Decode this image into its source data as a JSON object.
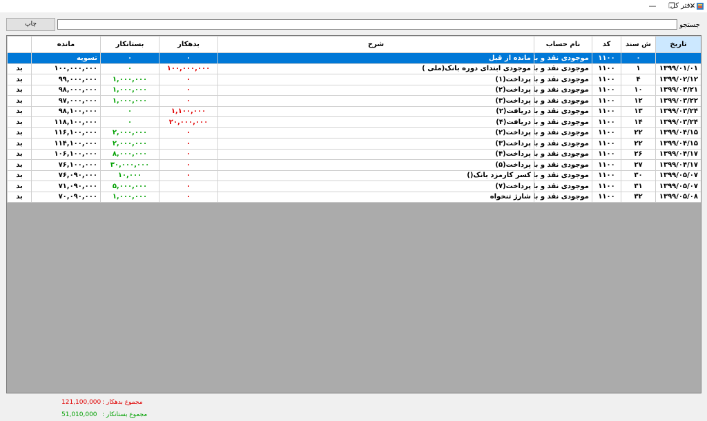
{
  "window": {
    "title": "دفتر کل",
    "minimize_glyph": "—",
    "restore_glyph": "❐",
    "close_glyph": "✕"
  },
  "search": {
    "label": "جستجو :",
    "value": "",
    "placeholder": ""
  },
  "toolbar": {
    "print_label": "چاپ"
  },
  "grid": {
    "headers": {
      "stub": "",
      "balance": "مانده",
      "credit": "بستانکار",
      "debit": "بدهکار",
      "description": "شرح",
      "account": "نام حساب",
      "code": "کد",
      "doc_no": "ش سند",
      "date": "تاریخ"
    },
    "rows": [
      {
        "stub": "",
        "balance": "تسویه",
        "credit": "۰",
        "debit": "۰",
        "description": "مانده از قبل",
        "account": "موجودی نقد و بانک",
        "code": "۱۱۰۰",
        "doc_no": "۰",
        "date": "",
        "selected": true
      },
      {
        "stub": "بد",
        "balance": "۱۰۰,۰۰۰,۰۰۰",
        "credit": "۰",
        "debit": "۱۰۰,۰۰۰,۰۰۰",
        "description": "موجودی ابتدای دوره بانک(ملی )",
        "account": "موجودی نقد و بانک",
        "code": "۱۱۰۰",
        "doc_no": "۱",
        "date": "۱۳۹۹/۰۱/۰۱"
      },
      {
        "stub": "بد",
        "balance": "۹۹,۰۰۰,۰۰۰",
        "credit": "۱,۰۰۰,۰۰۰",
        "debit": "۰",
        "description": "پرداخت(۱)",
        "account": "موجودی نقد و بانک",
        "code": "۱۱۰۰",
        "doc_no": "۴",
        "date": "۱۳۹۹/۰۲/۱۲"
      },
      {
        "stub": "بد",
        "balance": "۹۸,۰۰۰,۰۰۰",
        "credit": "۱,۰۰۰,۰۰۰",
        "debit": "۰",
        "description": "پرداخت(۲)",
        "account": "موجودی نقد و بانک",
        "code": "۱۱۰۰",
        "doc_no": "۱۰",
        "date": "۱۳۹۹/۰۳/۲۱"
      },
      {
        "stub": "بد",
        "balance": "۹۷,۰۰۰,۰۰۰",
        "credit": "۱,۰۰۰,۰۰۰",
        "debit": "۰",
        "description": "پرداخت(۳)",
        "account": "موجودی نقد و بانک",
        "code": "۱۱۰۰",
        "doc_no": "۱۲",
        "date": "۱۳۹۹/۰۳/۲۲"
      },
      {
        "stub": "بد",
        "balance": "۹۸,۱۰۰,۰۰۰",
        "credit": "۰",
        "debit": "۱,۱۰۰,۰۰۰",
        "description": "دریافت(۲)",
        "account": "موجودی نقد و بانک",
        "code": "۱۱۰۰",
        "doc_no": "۱۳",
        "date": "۱۳۹۹/۰۳/۲۴"
      },
      {
        "stub": "بد",
        "balance": "۱۱۸,۱۰۰,۰۰۰",
        "credit": "۰",
        "debit": "۲۰,۰۰۰,۰۰۰",
        "description": "دریافت(۴)",
        "account": "موجودی نقد و بانک",
        "code": "۱۱۰۰",
        "doc_no": "۱۴",
        "date": "۱۳۹۹/۰۳/۲۴"
      },
      {
        "stub": "بد",
        "balance": "۱۱۶,۱۰۰,۰۰۰",
        "credit": "۲,۰۰۰,۰۰۰",
        "debit": "۰",
        "description": "پرداخت(۲)",
        "account": "موجودی نقد و بانک",
        "code": "۱۱۰۰",
        "doc_no": "۲۲",
        "date": "۱۳۹۹/۰۴/۱۵"
      },
      {
        "stub": "بد",
        "balance": "۱۱۴,۱۰۰,۰۰۰",
        "credit": "۲,۰۰۰,۰۰۰",
        "debit": "۰",
        "description": "پرداخت(۳)",
        "account": "موجودی نقد و بانک",
        "code": "۱۱۰۰",
        "doc_no": "۲۲",
        "date": "۱۳۹۹/۰۴/۱۵"
      },
      {
        "stub": "بد",
        "balance": "۱۰۶,۱۰۰,۰۰۰",
        "credit": "۸,۰۰۰,۰۰۰",
        "debit": "۰",
        "description": "پرداخت(۴)",
        "account": "موجودی نقد و بانک",
        "code": "۱۱۰۰",
        "doc_no": "۲۶",
        "date": "۱۳۹۹/۰۴/۱۷"
      },
      {
        "stub": "بد",
        "balance": "۷۶,۱۰۰,۰۰۰",
        "credit": "۳۰,۰۰۰,۰۰۰",
        "debit": "۰",
        "description": "پرداخت(۵)",
        "account": "موجودی نقد و بانک",
        "code": "۱۱۰۰",
        "doc_no": "۲۷",
        "date": "۱۳۹۹/۰۴/۱۷"
      },
      {
        "stub": "بد",
        "balance": "۷۶,۰۹۰,۰۰۰",
        "credit": "۱۰,۰۰۰",
        "debit": "۰",
        "description": "کسر کارمزد بانک()",
        "account": "موجودی نقد و بانک",
        "code": "۱۱۰۰",
        "doc_no": "۳۰",
        "date": "۱۳۹۹/۰۵/۰۷"
      },
      {
        "stub": "بد",
        "balance": "۷۱,۰۹۰,۰۰۰",
        "credit": "۵,۰۰۰,۰۰۰",
        "debit": "۰",
        "description": "پرداخت(۷)",
        "account": "موجودی نقد و بانک",
        "code": "۱۱۰۰",
        "doc_no": "۳۱",
        "date": "۱۳۹۹/۰۵/۰۷"
      },
      {
        "stub": "بد",
        "balance": "۷۰,۰۹۰,۰۰۰",
        "credit": "۱,۰۰۰,۰۰۰",
        "debit": "۰",
        "description": "شارژ تنخواه",
        "account": "موجودی نقد و بانک",
        "code": "۱۱۰۰",
        "doc_no": "۳۲",
        "date": "۱۳۹۹/۰۵/۰۸"
      }
    ]
  },
  "totals": {
    "debit_label": "مجموع بدهکار :",
    "debit_value": "121,100,000",
    "credit_label": "مجموع بستانکار :",
    "credit_value": "51,010,000"
  },
  "colors": {
    "debit": "#e00000",
    "credit": "#00a000",
    "selection": "#0078d7",
    "header_selected": "#cce8ff"
  }
}
